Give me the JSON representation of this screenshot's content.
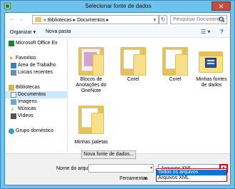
{
  "window": {
    "title": "Selecionar fonte de dados",
    "close_symbol": "✕",
    "icon": "excel-app-icon"
  },
  "address_bar": {
    "back_symbol": "←",
    "forward_symbol": "→",
    "path": "« Bibliotecas ▸ Documentos ▸",
    "refresh_symbol": "↻",
    "search_placeholder": "Pesquisar Documentos"
  },
  "toolbar": {
    "organize_label": "Organizar ▾",
    "new_folder_label": "Nova pasta",
    "view_symbol": "☰ ▾",
    "help_symbol": "?"
  },
  "sidebar": {
    "items": [
      {
        "label": "Microsoft Office Ex",
        "icon": "excel-icon"
      },
      {
        "label": "Favoritos",
        "icon": "star-icon"
      },
      {
        "label": "Área de Trabalho",
        "icon": "desktop-icon"
      },
      {
        "label": "Locais recentes",
        "icon": "recent-places-icon"
      },
      {
        "label": "Bibliotecas",
        "icon": "libraries-icon"
      },
      {
        "label": "Documentos",
        "icon": "documents-icon"
      },
      {
        "label": "Imagens",
        "icon": "pictures-icon"
      },
      {
        "label": "Músicas",
        "icon": "music-icon"
      },
      {
        "label": "Vídeos",
        "icon": "videos-icon"
      },
      {
        "label": "Grupo doméstico",
        "icon": "homegroup-icon"
      }
    ]
  },
  "files": [
    {
      "name": "Blocos de Anotações do OneNote",
      "icon": "onenote-folder-icon"
    },
    {
      "name": "Corel",
      "icon": "folder-icon"
    },
    {
      "name": "Corel",
      "icon": "folder-icon"
    },
    {
      "name": "Minhas fontes de dados",
      "icon": "data-sources-folder-icon"
    },
    {
      "name": "Minhas paletas",
      "icon": "folder-icon"
    }
  ],
  "bottom": {
    "new_source_label": "Nova fonte de dados...",
    "filename_label": "Nome do arquivo:",
    "filename_value": "",
    "filetype_value": "Arquivos XML",
    "tools_label": "Ferramentas",
    "dropdown_symbol": "▾"
  },
  "filetype_options": [
    "Todos os arquivos",
    "Arquivos XML"
  ],
  "colors": {
    "accent": "#6fc2ec",
    "selection": "#0078d7",
    "highlight_border": "#e00000"
  }
}
